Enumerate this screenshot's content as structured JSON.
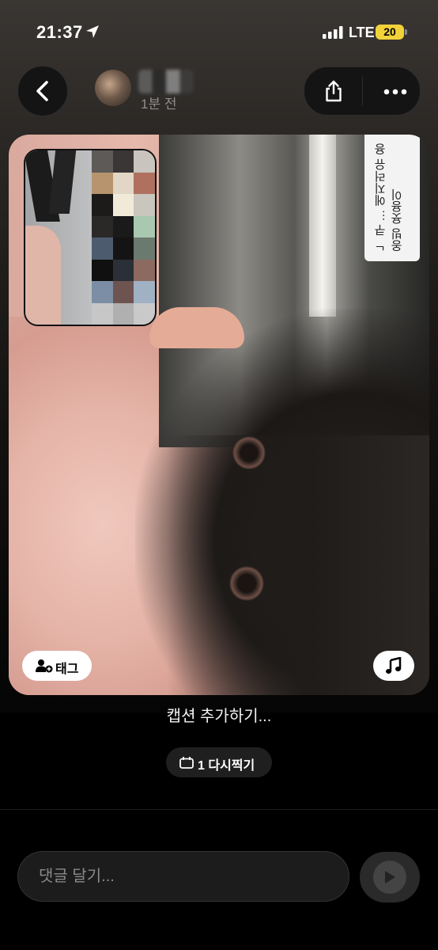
{
  "status_bar": {
    "time": "21:37",
    "network": "LTE",
    "battery": "20"
  },
  "header": {
    "timestamp": "1분 전"
  },
  "photo": {
    "tag_label": "태그",
    "sign_text": "ᄂ 쿠 … 에지러유 용옹빙 욧용이"
  },
  "caption": {
    "text": "캡션 추가하기..."
  },
  "retake": {
    "label": "1 다시찍기"
  },
  "comment": {
    "placeholder": "댓글 달기..."
  },
  "icons": [
    "location-arrow-icon",
    "signal-bars-icon",
    "battery-icon",
    "back-chevron-icon",
    "share-icon",
    "more-icon",
    "add-person-icon",
    "music-note-icon",
    "retake-calendar-icon",
    "send-icon"
  ]
}
